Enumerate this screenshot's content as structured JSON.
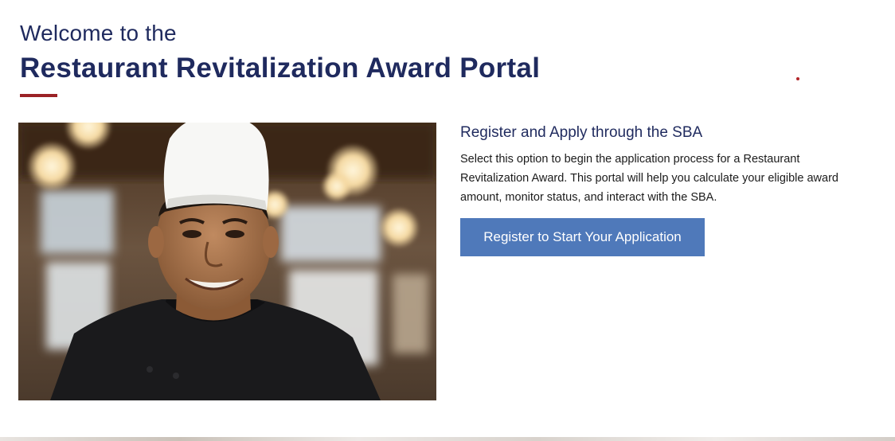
{
  "header": {
    "welcome": "Welcome to the",
    "title": "Restaurant Revitalization Award Portal"
  },
  "colors": {
    "navy": "#1f2a5e",
    "accent_red": "#9b2226",
    "button_blue": "#4f79ba"
  },
  "hero_image": {
    "alt": "Smiling chef wearing a white toque and black chef jacket in a restaurant"
  },
  "register": {
    "heading": "Register and Apply through the SBA",
    "description": "Select this option to begin the application process for a Restaurant Revitalization Award. This portal will help you calculate your eligible award amount, monitor status, and interact with the SBA.",
    "button_label": "Register to Start Your Application"
  }
}
